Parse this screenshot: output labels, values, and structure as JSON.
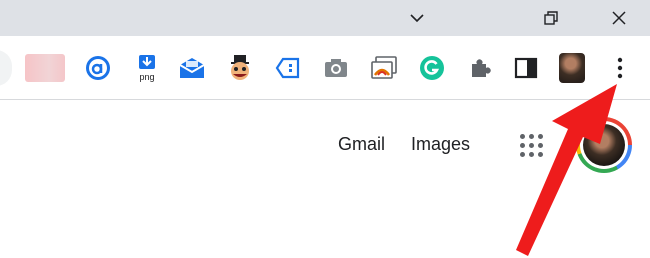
{
  "window": {
    "controls": [
      {
        "name": "tab-search-icon"
      },
      {
        "name": "restore-icon"
      },
      {
        "name": "close-icon"
      }
    ]
  },
  "toolbar": {
    "extensions": [
      {
        "name": "blurred-extension-icon",
        "color": "#f4c6c9"
      },
      {
        "name": "a-circle-extension-icon",
        "color": "#1a73e8"
      },
      {
        "name": "png-download-extension-icon",
        "color": "#1a73e8",
        "text": "png"
      },
      {
        "name": "mail-envelope-extension-icon",
        "color": "#1a73e8"
      },
      {
        "name": "mascot-extension-icon",
        "color": "#8b1a1a"
      },
      {
        "name": "tag-extension-icon",
        "color": "#1a73e8"
      },
      {
        "name": "camera-extension-icon",
        "color": "#80868b"
      },
      {
        "name": "window-screenshot-extension-icon",
        "color": "#e37400"
      },
      {
        "name": "grammarly-icon",
        "color": "#15c39a"
      },
      {
        "name": "puzzle-extensions-icon",
        "color": "#5f6368"
      },
      {
        "name": "side-panel-icon",
        "color": "#5f6368"
      },
      {
        "name": "profile-avatar-icon",
        "color": "#3d2e24"
      },
      {
        "name": "more-menu-icon",
        "color": "#5f6368"
      }
    ]
  },
  "google": {
    "links": {
      "gmail": "Gmail",
      "images": "Images"
    },
    "apps_icon": "apps-grid-icon",
    "avatar_ring_colors": [
      "#ea4335",
      "#4285f4",
      "#34a853",
      "#fbbc05"
    ]
  },
  "annotation": {
    "arrow_color": "#ee1c1c",
    "points_to": "more-menu-icon"
  }
}
